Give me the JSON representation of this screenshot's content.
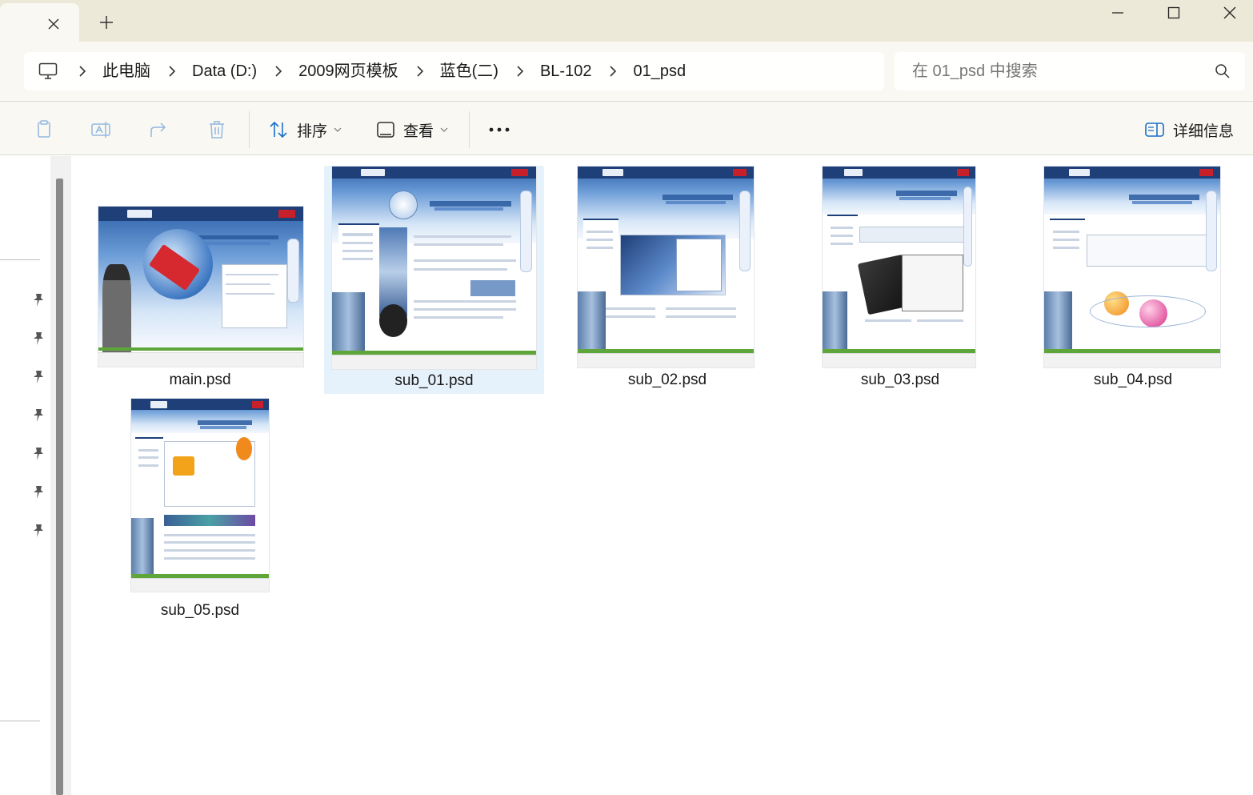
{
  "window": {
    "controls": {
      "minimize": "minimize-icon",
      "maximize": "maximize-icon",
      "close": "close-icon"
    },
    "tab": {
      "close_icon": "close-icon",
      "new_tab_icon": "plus-icon"
    }
  },
  "address": {
    "root_icon": "computer-icon",
    "separator_icon": "chevron-right-icon",
    "crumbs": [
      "此电脑",
      "Data (D:)",
      "2009网页模板",
      "蓝色(二)",
      "BL-102",
      "01_psd"
    ]
  },
  "search": {
    "placeholder": "在 01_psd 中搜索",
    "icon": "search-icon"
  },
  "toolbar": {
    "copy_icon": "copy-icon",
    "rename_icon": "rename-icon",
    "share_icon": "share-icon",
    "delete_icon": "trash-icon",
    "sort_label": "排序",
    "view_label": "查看",
    "more_label": "•••",
    "details_label": "详细信息"
  },
  "nav": {
    "pinned_count": 7,
    "pin_icon": "pin-icon"
  },
  "files": [
    {
      "name": "main.psd",
      "selected": false
    },
    {
      "name": "sub_01.psd",
      "selected": true
    },
    {
      "name": "sub_02.psd",
      "selected": false
    },
    {
      "name": "sub_03.psd",
      "selected": false
    },
    {
      "name": "sub_04.psd",
      "selected": false
    },
    {
      "name": "sub_05.psd",
      "selected": false
    }
  ],
  "colors": {
    "titlebar": "#ece9d8",
    "chrome": "#f9f8f3",
    "selection": "#e5f1fb",
    "template_nav": "#1f3f78",
    "template_accent": "#c8202a"
  }
}
